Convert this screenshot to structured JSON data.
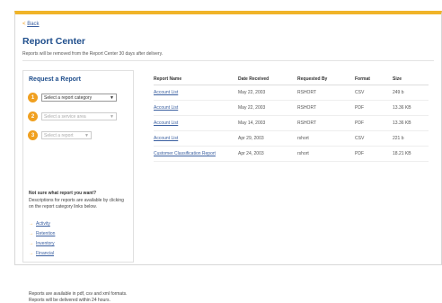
{
  "nav": {
    "back_arrow": "<",
    "back_label": "Back"
  },
  "page": {
    "title": "Report Center",
    "subtitle": "Reports will be removed from the Report Center 30 days after delivery."
  },
  "request": {
    "heading": "Request a Report",
    "steps": [
      {
        "num": "1",
        "value": "Select a report category"
      },
      {
        "num": "2",
        "value": "Select a service area"
      },
      {
        "num": "3",
        "value": "Select a report"
      }
    ],
    "help_heading": "Not sure what report you want?",
    "help_text": "Descriptions for reports are available by clicking on the report category links below.",
    "links": [
      "Activity",
      "Retention",
      "Inventory",
      "Financial"
    ],
    "link_arrow": "→",
    "footer": "Reports are available in pdf, csv and xml formats. Reports will be delivered within 24 hours."
  },
  "table": {
    "headers": [
      "Report Name",
      "Date Received",
      "Requested By",
      "Format",
      "Size"
    ],
    "rows": [
      [
        "Account List",
        "May 22, 2003",
        "RSHORT",
        "CSV",
        "249 b"
      ],
      [
        "Account List",
        "May 22, 2003",
        "RSHORT",
        "PDF",
        "13.36 KB"
      ],
      [
        "Account List",
        "May 14, 2003",
        "RSHORT",
        "PDF",
        "13.36 KB"
      ],
      [
        "Account List",
        "Apr 29, 2003",
        "rshort",
        "CSV",
        "221 b"
      ],
      [
        "Customer Classification Report",
        "Apr 24, 2003",
        "rshort",
        "PDF",
        "18.21 KB"
      ]
    ]
  },
  "colors": {
    "accent": "#f0b429",
    "heading": "#1f4e8c",
    "link": "#3a5fa0"
  }
}
